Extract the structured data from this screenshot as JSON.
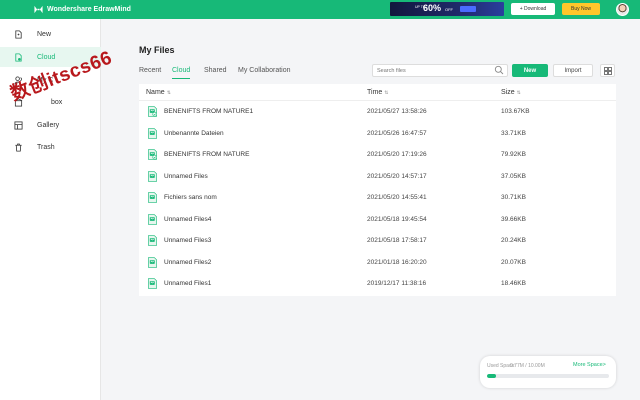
{
  "app": {
    "title": "Wondershare EdrawMind"
  },
  "header": {
    "promo": {
      "up_to": "UP TO",
      "percent": "60%",
      "off": "OFF"
    },
    "download_label": "+ Download",
    "buynow_label": "Buy Now"
  },
  "sidebar": {
    "items": [
      {
        "label": "New",
        "icon": "new-file-icon",
        "active": false
      },
      {
        "label": "Cloud",
        "icon": "cloud-doc-icon",
        "active": true
      },
      {
        "label": "My C",
        "icon": "users-icon",
        "active": false
      },
      {
        "label": "box",
        "icon": "box-icon",
        "active": false
      },
      {
        "label": "Gallery",
        "icon": "gallery-icon",
        "active": false
      },
      {
        "label": "Trash",
        "icon": "trash-icon",
        "active": false
      }
    ],
    "watermark": "数创itscs66"
  },
  "main": {
    "title": "My Files",
    "tabs": [
      {
        "label": "Recent",
        "active": false
      },
      {
        "label": "Cloud",
        "active": true
      },
      {
        "label": "Shared",
        "active": false
      },
      {
        "label": "My Collaboration",
        "active": false
      }
    ],
    "search_placeholder": "Search files",
    "new_label": "New",
    "import_label": "Import"
  },
  "table": {
    "headers": {
      "name": "Name",
      "time": "Time",
      "size": "Size"
    },
    "rows": [
      {
        "name": "BENENIFTS FROM NATURE1",
        "time": "2021/05/27 13:58:26",
        "size": "103.67KB",
        "synced": true
      },
      {
        "name": "Unbenannte Dateien",
        "time": "2021/05/26 16:47:57",
        "size": "33.71KB",
        "synced": false
      },
      {
        "name": "BENENIFTS FROM NATURE",
        "time": "2021/05/20 17:19:26",
        "size": "79.92KB",
        "synced": true
      },
      {
        "name": "Unnamed Files",
        "time": "2021/05/20 14:57:17",
        "size": "37.05KB",
        "synced": false
      },
      {
        "name": "Fichiers sans nom",
        "time": "2021/05/20 14:55:41",
        "size": "30.71KB",
        "synced": false
      },
      {
        "name": "Unnamed Files4",
        "time": "2021/05/18 19:45:54",
        "size": "39.66KB",
        "synced": false
      },
      {
        "name": "Unnamed Files3",
        "time": "2021/05/18 17:58:17",
        "size": "20.24KB",
        "synced": false
      },
      {
        "name": "Unnamed Files2",
        "time": "2021/01/18 16:20:20",
        "size": "20.07KB",
        "synced": false
      },
      {
        "name": "Unnamed Files1",
        "time": "2019/12/17 11:38:16",
        "size": "18.46KB",
        "synced": false
      }
    ]
  },
  "storage": {
    "label": "Used Space:",
    "value": "0.77M / 10.00M",
    "more_label": "More Space>",
    "used_fraction": 0.077
  },
  "colors": {
    "accent": "#17b978",
    "buynow": "#ffc62b",
    "watermark": "#b8181c"
  }
}
